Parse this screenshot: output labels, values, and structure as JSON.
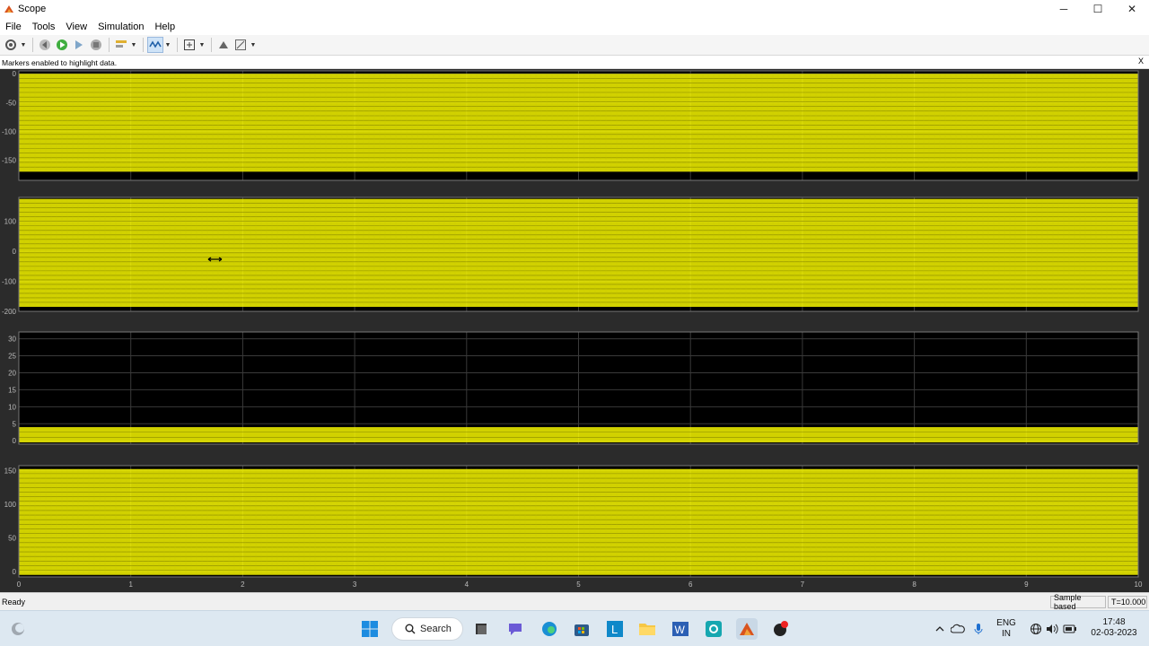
{
  "window": {
    "title": "Scope",
    "controls": [
      "─",
      "☐",
      "✕"
    ]
  },
  "menu": [
    "File",
    "Tools",
    "View",
    "Simulation",
    "Help"
  ],
  "toolbar": {
    "icons": [
      "settings-icon",
      "step-back-icon",
      "run-icon",
      "step-forward-icon",
      "stop-icon",
      "highlight-icon",
      "triggers-icon",
      "zoom-fit-icon",
      "style-icon",
      "measure-icon"
    ]
  },
  "info": {
    "message": "Markers enabled to highlight data.",
    "close": "X"
  },
  "x_ticks": [
    "0",
    "1",
    "2",
    "3",
    "4",
    "5",
    "6",
    "7",
    "8",
    "9",
    "10"
  ],
  "plots": [
    {
      "name": "plot-1",
      "y_ticks": [
        "0",
        "-50",
        "-100",
        "-150"
      ],
      "ylim": [
        -185,
        5
      ]
    },
    {
      "name": "plot-2",
      "y_ticks": [
        "100",
        "0",
        "-100",
        "-200"
      ],
      "ylim": [
        -200,
        180
      ]
    },
    {
      "name": "plot-3",
      "y_ticks": [
        "30",
        "25",
        "20",
        "15",
        "10",
        "5",
        "0"
      ],
      "ylim": [
        -1,
        32
      ]
    },
    {
      "name": "plot-4",
      "y_ticks": [
        "150",
        "100",
        "50",
        "0"
      ],
      "ylim": [
        -8,
        157
      ]
    }
  ],
  "chart_data": [
    {
      "type": "line",
      "xlim": [
        0,
        10
      ],
      "ylim": [
        -185,
        5
      ],
      "band": [
        -170,
        0
      ],
      "color": "#ffff00"
    },
    {
      "type": "line",
      "xlim": [
        0,
        10
      ],
      "ylim": [
        -200,
        180
      ],
      "band": [
        -185,
        175
      ],
      "color": "#ffff00"
    },
    {
      "type": "line",
      "xlim": [
        0,
        10
      ],
      "ylim": [
        -1,
        32
      ],
      "band": [
        -0.5,
        4
      ],
      "color": "#ffff00"
    },
    {
      "type": "line",
      "xlim": [
        0,
        10
      ],
      "ylim": [
        -8,
        157
      ],
      "band": [
        -5,
        152
      ],
      "color": "#ffff00"
    }
  ],
  "status": {
    "ready": "Ready",
    "mode": "Sample based",
    "time": "T=10.000"
  },
  "taskbar": {
    "search": "Search",
    "icons": [
      "weather-icon",
      "windows-start-icon",
      "task-view-icon",
      "chat-icon",
      "edge-icon",
      "store-icon",
      "l-app-icon",
      "file-explorer-icon",
      "word-icon",
      "app-icon",
      "matlab-icon",
      "recorder-icon"
    ],
    "lang": "ENG",
    "region": "IN",
    "time": "17:48",
    "date": "02-03-2023"
  }
}
